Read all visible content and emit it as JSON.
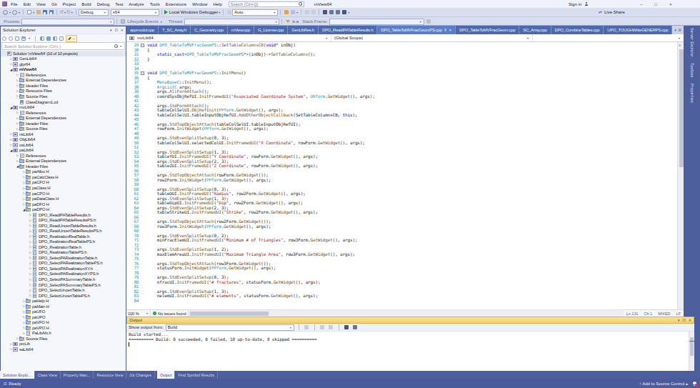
{
  "title_bar": {
    "menus": [
      "File",
      "Edit",
      "View",
      "Git",
      "Project",
      "Build",
      "Debug",
      "Test",
      "Analyze",
      "Tools",
      "Extensions",
      "Window",
      "Help"
    ],
    "search_placeholder": "Search (Ctrl+Q)",
    "solution_name": "mView64",
    "sign_in": "Sign in",
    "live_share": "Live Share"
  },
  "toolbar": {
    "configuration": "Debug",
    "platform": "x64",
    "run_label": "Local Windows Debugger",
    "watch_mode": "Auto"
  },
  "debug_toolbar": {
    "process_label": "Process:",
    "lifecycle_label": "Lifecycle Events",
    "thread_label": "Thread:",
    "stack_frame_label": "Stack Frame:"
  },
  "solution_explorer": {
    "title": "Solution Explorer",
    "search_placeholder": "Search Solution Explorer (Ctrl+;)",
    "tree": [
      [
        0,
        "n",
        "sol",
        "Solution 'mView64' (10 of 10 projects)",
        0,
        1
      ],
      [
        1,
        "c",
        "prj",
        "GenLib64",
        0,
        0
      ],
      [
        1,
        "c",
        "prj",
        "glpr64",
        0,
        0
      ],
      [
        1,
        "e",
        "prj",
        "mView64",
        1,
        0
      ],
      [
        2,
        "c",
        "refs",
        "References",
        0,
        0
      ],
      [
        2,
        "c",
        "ext",
        "External Dependencies",
        0,
        0
      ],
      [
        2,
        "c",
        "fil",
        "Header Files",
        0,
        0
      ],
      [
        2,
        "c",
        "fil",
        "Resource Files",
        0,
        0
      ],
      [
        2,
        "c",
        "fil",
        "Source Files",
        0,
        0
      ],
      [
        2,
        "n",
        "dia",
        "ClassDiagram1.cd",
        0,
        0
      ],
      [
        1,
        "e",
        "prj",
        "mvLib64",
        0,
        0
      ],
      [
        2,
        "c",
        "refs",
        "References",
        0,
        0
      ],
      [
        2,
        "c",
        "ext",
        "External Dependencies",
        0,
        0
      ],
      [
        2,
        "c",
        "fil",
        "Header Files",
        0,
        0
      ],
      [
        2,
        "c",
        "fil",
        "Source Files",
        0,
        0
      ],
      [
        1,
        "c",
        "prj",
        "nsLib64",
        0,
        0
      ],
      [
        1,
        "c",
        "prj",
        "ObjLib64",
        0,
        0
      ],
      [
        1,
        "c",
        "prj",
        "osLib64",
        0,
        0
      ],
      [
        1,
        "e",
        "prj",
        "paLib64",
        0,
        0
      ],
      [
        2,
        "c",
        "refs",
        "References",
        0,
        0
      ],
      [
        2,
        "c",
        "ext",
        "External Dependencies",
        0,
        0
      ],
      [
        2,
        "e",
        "fil",
        "Header Files",
        0,
        0
      ],
      [
        3,
        "c",
        "fil",
        "paAlloc H",
        0,
        0
      ],
      [
        3,
        "c",
        "fil",
        "paCalcClass H",
        0,
        0
      ],
      [
        3,
        "c",
        "fil",
        "paCFO H",
        0,
        0
      ],
      [
        3,
        "c",
        "fil",
        "paClass H",
        0,
        0
      ],
      [
        3,
        "c",
        "fil",
        "paCPO H",
        0,
        0
      ],
      [
        3,
        "c",
        "fil",
        "paDataClass H",
        0,
        0
      ],
      [
        3,
        "c",
        "fil",
        "paDFO H",
        0,
        0
      ],
      [
        3,
        "e",
        "fil",
        "paDPO H",
        0,
        0
      ],
      [
        4,
        "c",
        "hfile",
        "DPO_ReadIPATableResults.h",
        0,
        0
      ],
      [
        4,
        "c",
        "hfile",
        "DPO_ReadIPATableResultsPS.h",
        0,
        0
      ],
      [
        4,
        "c",
        "hfile",
        "DPO_ReadUncertTableResults.h",
        0,
        0
      ],
      [
        4,
        "c",
        "hfile",
        "DPO_ReadUncertTableResultsPS.h",
        0,
        0
      ],
      [
        4,
        "c",
        "hfile",
        "DPO_RealizationRealTable.h",
        0,
        0
      ],
      [
        4,
        "c",
        "hfile",
        "DPO_RealizationRealTablePS.h",
        0,
        0
      ],
      [
        4,
        "c",
        "hfile",
        "DPO_RealizationTable.h",
        0,
        0
      ],
      [
        4,
        "c",
        "hfile",
        "DPO_RealizationTablePS.h",
        0,
        0
      ],
      [
        4,
        "c",
        "hfile",
        "DPO_SelectPARealizationTable.h",
        0,
        0
      ],
      [
        4,
        "c",
        "hfile",
        "DPO_SelectPARealizationTablePS.h",
        0,
        0
      ],
      [
        4,
        "c",
        "hfile",
        "DPO_SelectPARealizationXY.h",
        0,
        0
      ],
      [
        4,
        "c",
        "hfile",
        "DPO_SelectPARealizationXYPS.h",
        0,
        0
      ],
      [
        4,
        "c",
        "hfile",
        "DPO_SelectPASummaryTable.h",
        0,
        0
      ],
      [
        4,
        "c",
        "hfile",
        "DPO_SelectPASummaryTablePS.h",
        0,
        0
      ],
      [
        4,
        "c",
        "hfile",
        "DPO_SelectUncertTable.h",
        0,
        0
      ],
      [
        4,
        "c",
        "hfile",
        "DPO_SelectUncertTablePS.h",
        0,
        0
      ],
      [
        3,
        "c",
        "fil",
        "paHelp H",
        0,
        0
      ],
      [
        3,
        "c",
        "fil",
        "paMain H",
        0,
        0
      ],
      [
        3,
        "c",
        "fil",
        "paUFO",
        0,
        0
      ],
      [
        3,
        "c",
        "fil",
        "paUPO",
        0,
        0
      ],
      [
        3,
        "c",
        "fil",
        "paVFO H",
        0,
        0
      ],
      [
        3,
        "c",
        "fil",
        "paVPO H",
        0,
        0
      ],
      [
        3,
        "c",
        "hfile",
        "PaLibAfx.h",
        0,
        0
      ],
      [
        2,
        "c",
        "fil",
        "Source Files",
        0,
        0
      ],
      [
        1,
        "c",
        "prj",
        "prcLib",
        0,
        0
      ],
      [
        1,
        "c",
        "prj",
        "saLib64",
        0,
        0
      ]
    ],
    "bottom_tabs": [
      "Solution Explo...",
      "Class View",
      "Property Man...",
      "Resource View",
      "Git Changes"
    ]
  },
  "editor": {
    "tabs": [
      {
        "label": "appmodul.cpp",
        "active": false
      },
      {
        "label": "T_SC_Array.h",
        "active": false
      },
      {
        "label": "C_Geometry.cpp",
        "active": false
      },
      {
        "label": "mView.cpp",
        "active": false
      },
      {
        "label": "G_License.cpp",
        "active": false
      },
      {
        "label": "GenLibRes.h",
        "active": false
      },
      {
        "label": "DPO_ReadIPATableResults.h",
        "active": false
      },
      {
        "label": "DPO_TableToMVFracGeomPS.cpp",
        "active": true
      },
      {
        "label": "DPO_TableToMVFracGeom.cpp",
        "active": false
      },
      {
        "label": "SC_Array.cpp",
        "active": false
      },
      {
        "label": "DPO_CombineTables.cpp",
        "active": false
      },
      {
        "label": "UPO_TOUGHWriteGENERPS.cpp",
        "active": false
      }
    ],
    "breadcrumb": {
      "project": "mvLib64",
      "scope": "(Global Scope)"
    },
    "code_lines": [
      {
        "n": 29,
        "c": "void DPO_TableToMVFracGeomPS::SetTableColumnsCB(void* inObj)",
        "o": 1
      },
      {
        "n": 30,
        "c": "{"
      },
      {
        "n": 31,
        "c": "    static_cast<DPO_TableToMVFracGeomPS*>(inObj)->SetTableColumns();"
      },
      {
        "n": 32,
        "c": "}"
      },
      {
        "n": 33,
        "c": ""
      },
      {
        "n": 34,
        "c": ""
      },
      {
        "n": 35,
        "c": "void DPO_TableToMVFracGeomPS::InitMenu()",
        "o": 1
      },
      {
        "n": 36,
        "c": "{"
      },
      {
        "n": 37,
        "c": "    MenuBaseC::InitMenu();"
      },
      {
        "n": 38,
        "c": "    ArgListC args;"
      },
      {
        "n": 39,
        "c": "    args.AllFormAttach();"
      },
      {
        "n": 40,
        "c": "    coordSysObjRefUI.InitFramedUI(\"Associated Coordinate System\", URform.GetWidget(), args);"
      },
      {
        "n": 41,
        "c": ""
      },
      {
        "n": 42,
        "c": "    args.StdFormAttach();"
      },
      {
        "n": 43,
        "c": "    tableColSelUI.ObjRefInit(PPform.GetWidget(), args);"
      },
      {
        "n": 44,
        "c": "    tableColSelUI.tableInputObjRefUI.AddOtherObjectCallback(SetTableColumnsCB, this);"
      },
      {
        "n": 45,
        "c": ""
      },
      {
        "n": 46,
        "c": "    args.StdTopObjectAttach(tableColSelUI.tableInputObjRefUI);"
      },
      {
        "n": 47,
        "c": "    rowForm.InitWidget(PPform.GetWidget(), args);"
      },
      {
        "n": 48,
        "c": ""
      },
      {
        "n": 49,
        "c": "    args.StdEvenSplitSetup(0, 3);"
      },
      {
        "n": 50,
        "c": "    tableColSelUI.selectedColUI.InitFramedUI(\"X Coordinate\", rowForm.GetWidget(), args);"
      },
      {
        "n": 51,
        "c": ""
      },
      {
        "n": 52,
        "c": "    args.StdEvenSplitSetup(1, 3);"
      },
      {
        "n": 53,
        "c": "    tableYUI.InitFramedUI(\"Y Coordinate\", rowForm.GetWidget(), args);"
      },
      {
        "n": 54,
        "c": "    args.StdEvenSplitSetup(2, 3);"
      },
      {
        "n": 55,
        "c": "    tableZUI.InitFramedUI(\"Z Coordinate\", rowForm.GetWidget(), args);"
      },
      {
        "n": 56,
        "c": ""
      },
      {
        "n": 57,
        "c": "    args.StdTopObjectAttach(rowForm.GetWidget());"
      },
      {
        "n": 58,
        "c": "    row2Form.InitWidget(PPform.GetWidget(), args);"
      },
      {
        "n": 59,
        "c": ""
      },
      {
        "n": 60,
        "c": "    args.StdEvenSplitSetup(0, 3);"
      },
      {
        "n": 61,
        "c": "    tableDUI.InitFramedUI(\"Radius\", row2Form.GetWidget(), args);"
      },
      {
        "n": 62,
        "c": "    args.StdEvenSplitSetup(1, 3);"
      },
      {
        "n": 63,
        "c": "    tableDipUI.InitFramedUI(\"Dip\", row2Form.GetWidget(), args);"
      },
      {
        "n": 64,
        "c": "    args.StdEvenSplitSetup(2, 3);"
      },
      {
        "n": 65,
        "c": "    tableStrikeUI.InitFramedUI(\"Strike\", row2Form.GetWidget(), args);"
      },
      {
        "n": 66,
        "c": ""
      },
      {
        "n": 67,
        "c": "    args.StdTopObjectAttach(row2Form.GetWidget());"
      },
      {
        "n": 68,
        "c": "    row3Form.InitWidget(PPform.GetWidget(), args);"
      },
      {
        "n": 69,
        "c": ""
      },
      {
        "n": 70,
        "c": "    args.StdEvenSplitSetup(0, 2);"
      },
      {
        "n": 71,
        "c": "    minFracElemUI.InitFramedUI(\"Minimum # of Triangles\", row3Form.GetWidget(), args);"
      },
      {
        "n": 72,
        "c": ""
      },
      {
        "n": 73,
        "c": "    args.StdEvenSplitSetup(1, 2);"
      },
      {
        "n": 74,
        "c": "    maxElemAreaUI.InitFramedUI(\"Maximum Triangle Area\", row3Form.GetWidget(), args);"
      },
      {
        "n": 75,
        "c": ""
      },
      {
        "n": 76,
        "c": "    args.StdTopObjectAttach(row3Form.GetWidget());"
      },
      {
        "n": 77,
        "c": "    statusForm.InitWidget(PPform.GetWidget(), args);"
      },
      {
        "n": 78,
        "c": ""
      },
      {
        "n": 79,
        "c": "    args.StdEvenSplitSetup(0, 3);"
      },
      {
        "n": 80,
        "c": "    nfracUI.InitFramedUI(\"# fractures\", statusForm.GetWidget(), args);"
      },
      {
        "n": 81,
        "c": ""
      },
      {
        "n": 82,
        "c": "    args.StdEvenSplitSetup(1, 3);"
      },
      {
        "n": 83,
        "c": "    nelemUI.InitFramedUI(\"# elements\", statusForm.GetWidget(), args);"
      },
      {
        "n": 84,
        "c": ""
      }
    ],
    "zoom_level": "100 %",
    "issues_text": "No issues found",
    "status": {
      "line": "Ln 131",
      "ch": "Ch 1",
      "indent": "MIXED",
      "eol": "LF"
    }
  },
  "right_tabs": [
    "Server Explorer",
    "Toolbox",
    "Properties"
  ],
  "output": {
    "title": "Output",
    "show_output_label": "Show output from:",
    "source": "Build",
    "lines": [
      "Build started...",
      "========== Build: 0 succeeded, 0 failed, 10 up-to-date, 0 skipped =========="
    ],
    "tabs": [
      "Output",
      "Find Symbol Results"
    ],
    "active_tab": "Output"
  },
  "status_bar": {
    "ready": "Ready",
    "add_to_source_control": "Add to Source Control"
  }
}
